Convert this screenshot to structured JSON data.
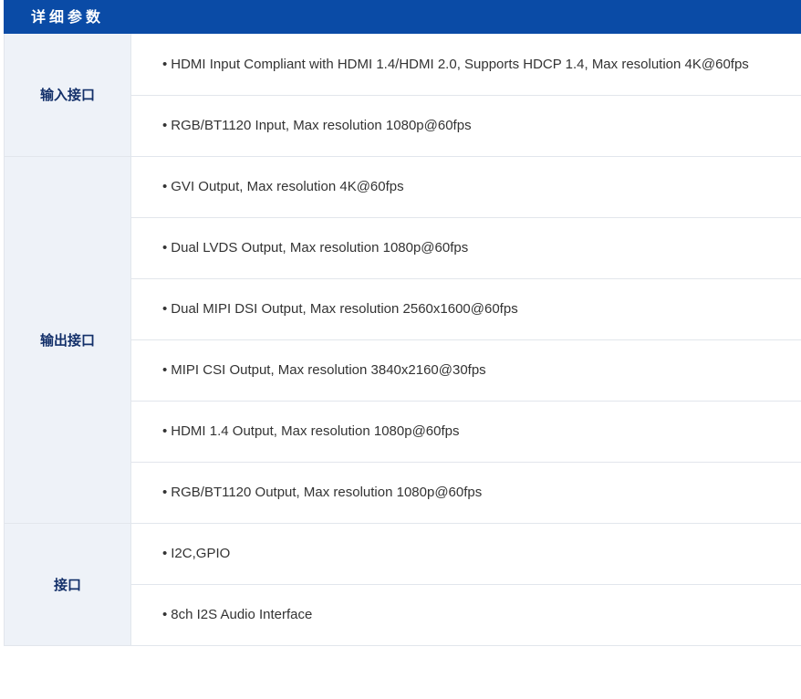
{
  "header": {
    "title": "详细参数"
  },
  "sections": [
    {
      "category": "输入接口",
      "items": [
        "HDMI Input Compliant with HDMI 1.4/HDMI 2.0, Supports HDCP 1.4, Max resolution 4K@60fps",
        "RGB/BT1120 Input, Max resolution 1080p@60fps"
      ]
    },
    {
      "category": "输出接口",
      "items": [
        "GVI Output, Max resolution 4K@60fps",
        "Dual LVDS Output, Max resolution 1080p@60fps",
        "Dual MIPI DSI Output, Max resolution 2560x1600@60fps",
        "MIPI CSI Output, Max resolution 3840x2160@30fps",
        "HDMI 1.4 Output, Max resolution 1080p@60fps",
        "RGB/BT1120 Output, Max resolution 1080p@60fps"
      ]
    },
    {
      "category": "接口",
      "items": [
        "I2C,GPIO",
        "8ch I2S Audio Interface"
      ]
    }
  ],
  "bullet": "•"
}
